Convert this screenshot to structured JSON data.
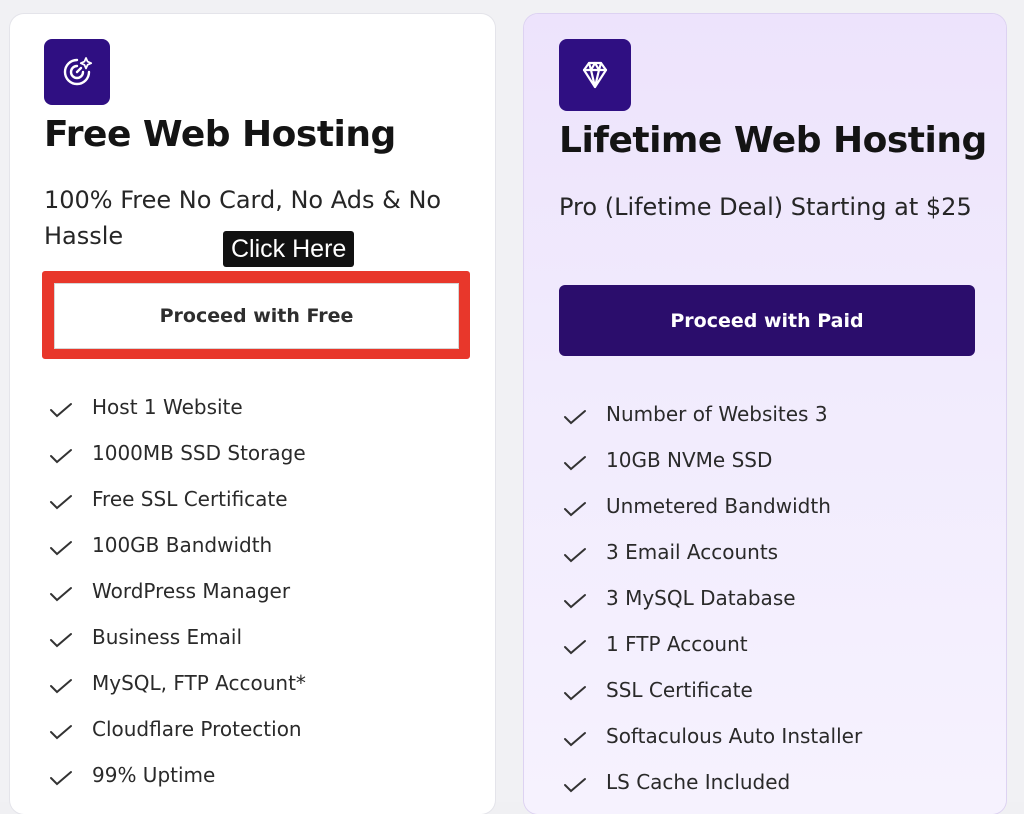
{
  "free_plan": {
    "icon": "target-star-icon",
    "title": "Free Web Hosting",
    "subtitle": "100% Free No Card, No Ads & No Hassle",
    "tooltip": "Click Here",
    "button_label": "Proceed with Free",
    "features": [
      "Host 1 Website",
      "1000MB SSD Storage",
      "Free SSL Certificate",
      "100GB Bandwidth",
      "WordPress Manager",
      "Business Email",
      "MySQL, FTP Account*",
      "Cloudflare Protection",
      "99% Uptime"
    ]
  },
  "paid_plan": {
    "icon": "diamond-icon",
    "title": "Lifetime Web Hosting",
    "subtitle": "Pro (Lifetime Deal) Starting at $25",
    "button_label": "Proceed with Paid",
    "features": [
      "Number of Websites 3",
      "10GB NVMe SSD",
      "Unmetered Bandwidth",
      "3 Email Accounts",
      "3 MySQL Database",
      "1 FTP Account",
      "SSL Certificate",
      "Softaculous Auto Installer",
      "LS Cache Included"
    ]
  },
  "colors": {
    "brand_purple": "#2f0f82",
    "paid_button": "#2b0d6c",
    "highlight_red": "#e8372b",
    "tooltip_bg": "#111111"
  }
}
